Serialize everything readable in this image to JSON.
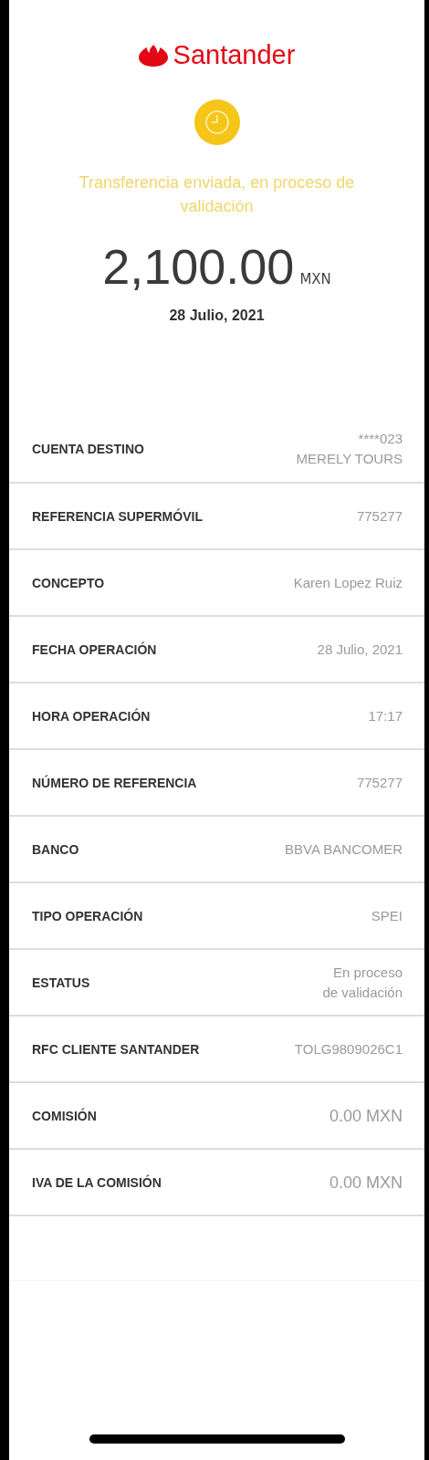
{
  "brand": {
    "name": "Santander"
  },
  "status": {
    "message": "Transferencia enviada, en proceso de validación"
  },
  "amount": {
    "value": "2,100.00",
    "currency": "MXN",
    "date": "28 Julio, 2021"
  },
  "details": [
    {
      "label": "CUENTA DESTINO",
      "value_lines": [
        "****023",
        "MERELY TOURS"
      ]
    },
    {
      "label": "REFERENCIA SUPERMÓVIL",
      "value_lines": [
        "775277"
      ]
    },
    {
      "label": "CONCEPTO",
      "value_lines": [
        "Karen Lopez Ruiz"
      ]
    },
    {
      "label": "FECHA OPERACIÓN",
      "value_lines": [
        "28 Julio, 2021"
      ]
    },
    {
      "label": "HORA OPERACIÓN",
      "value_lines": [
        "17:17"
      ]
    },
    {
      "label": "NÚMERO DE REFERENCIA",
      "value_lines": [
        "775277"
      ]
    },
    {
      "label": "BANCO",
      "value_lines": [
        "BBVA BANCOMER"
      ]
    },
    {
      "label": "TIPO OPERACIÓN",
      "value_lines": [
        "SPEI"
      ]
    },
    {
      "label": "ESTATUS",
      "value_lines": [
        "En proceso",
        "de validación"
      ]
    },
    {
      "label": "RFC CLIENTE SANTANDER",
      "value_lines": [
        "TOLG9809026C1"
      ]
    },
    {
      "label": "COMISIÓN",
      "value_lines": [
        "0.00 MXN"
      ],
      "large": true
    },
    {
      "label": "IVA DE LA COMISIÓN",
      "value_lines": [
        "0.00 MXN"
      ],
      "large": true
    }
  ]
}
